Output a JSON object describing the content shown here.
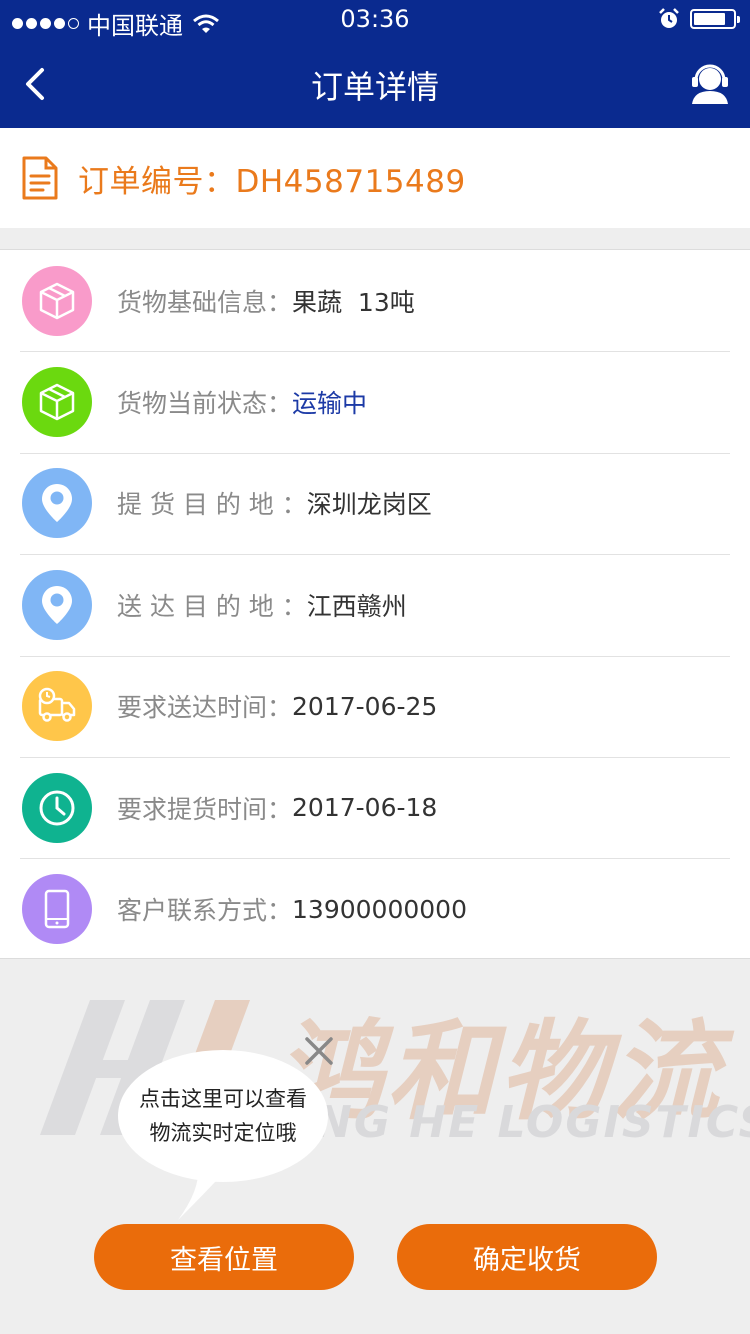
{
  "status_bar": {
    "carrier": "中国联通",
    "time": "03:36",
    "battery_level": 0.82
  },
  "nav": {
    "title": "订单详情",
    "back_icon": "chevron-left-icon",
    "service_icon": "customer-service-icon"
  },
  "order": {
    "text": "订单编号：DH458715489",
    "icon": "document-icon"
  },
  "info_rows": [
    {
      "label": "货物基础信息：",
      "value": "果蔬  13吨",
      "icon": "box-icon",
      "color": "#f99bca"
    },
    {
      "label": "货物当前状态：",
      "value": "运输中",
      "icon": "box-icon",
      "color": "#6bd90f"
    },
    {
      "label": "提 货 目 的 地 ：",
      "value": "深圳龙岗区",
      "icon": "location-pin-icon",
      "color": "#80b6f5"
    },
    {
      "label": "送 达 目 的 地 ：",
      "value": "江西赣州",
      "icon": "location-pin-icon",
      "color": "#80b6f5"
    },
    {
      "label": "要求送达时间：",
      "value": "2017-06-25",
      "icon": "delivery-truck-icon",
      "color": "#ffc64a"
    },
    {
      "label": "要求提货时间：",
      "value": "2017-06-18",
      "icon": "clock-icon",
      "color": "#0fb390"
    },
    {
      "label": "客户联系方式：",
      "value": "13900000000",
      "icon": "phone-icon",
      "color": "#b08af5"
    }
  ],
  "watermark": {
    "cn": "鸿和物流",
    "en": "NG HE LOGISTICS"
  },
  "tooltip": {
    "line1": "点击这里可以查看",
    "line2": "物流实时定位哦"
  },
  "buttons": {
    "view_location": "查看位置",
    "confirm_receipt": "确定收货"
  },
  "colors": {
    "nav_bg": "#0a2a8f",
    "accent": "#ea6c0b",
    "order_text": "#ea7a1c"
  }
}
